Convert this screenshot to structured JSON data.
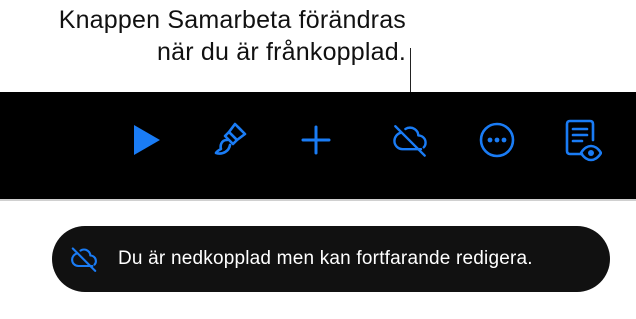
{
  "callout": {
    "line1": "Knappen Samarbeta förändras",
    "line2": "när du är frånkopplad."
  },
  "toolbar": {
    "accent_color": "#1a7cf5",
    "buttons": [
      {
        "name": "play-button",
        "icon": "play-icon"
      },
      {
        "name": "format-button",
        "icon": "paintbrush-icon"
      },
      {
        "name": "insert-button",
        "icon": "plus-icon"
      },
      {
        "name": "collaborate-button",
        "icon": "cloud-offline-icon"
      },
      {
        "name": "more-button",
        "icon": "ellipsis-circle-icon"
      },
      {
        "name": "reading-view-button",
        "icon": "document-view-icon"
      }
    ]
  },
  "banner": {
    "icon": "cloud-offline-icon",
    "message": "Du är nedkopplad men kan fortfarande redigera."
  }
}
